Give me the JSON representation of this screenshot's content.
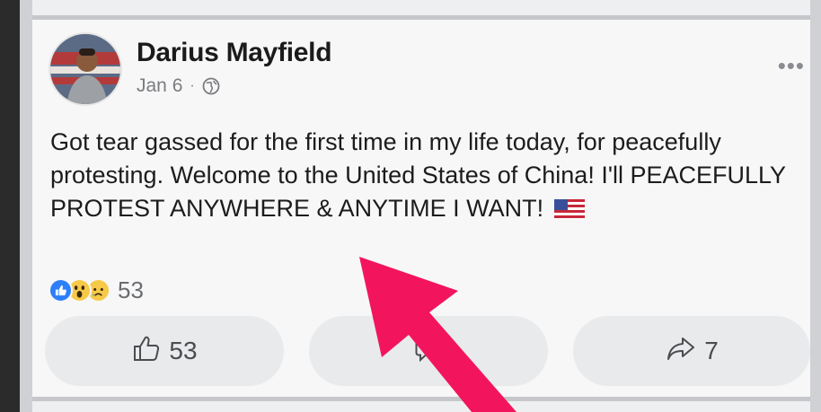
{
  "post": {
    "author_name": "Darius Mayfield",
    "date": "Jan 6",
    "separator": "·",
    "privacy_icon": "globe-icon",
    "more_icon": "•••",
    "text": "Got tear gassed for the first time in my life today, for peacefully protesting. Welcome to the United States of China! I'll PEACEFULLY PROTEST ANYWHERE & ANYTIME I WANT!",
    "emoji": "us-flag-icon"
  },
  "reactions": {
    "types": [
      "like",
      "wow",
      "sad"
    ],
    "count": "53"
  },
  "actions": {
    "like_count": "53",
    "share_count": "7"
  },
  "colors": {
    "like_blue": "#2d7ff9",
    "arrow_pink": "#f2155d",
    "card_bg": "#f7f7f8",
    "button_bg": "#e9eaec"
  }
}
